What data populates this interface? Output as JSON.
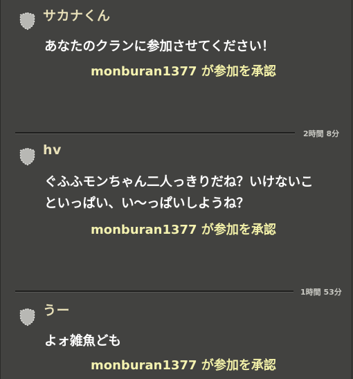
{
  "posts": [
    {
      "username": "サカナくん",
      "message": "あなたのクランに参加させてください！",
      "approval_member": "monburan1377",
      "approval_text": " が参加を承認"
    },
    {
      "username": "hv",
      "message": "ぐふふモンちゃん二人っきりだね？いけないこ\nといっぱい、い〜っぱいしようね？",
      "approval_member": "monburan1377",
      "approval_text": " が参加を承認"
    },
    {
      "username": "うー",
      "message": "よォ雑魚ども",
      "approval_member": "monburan1377",
      "approval_text": " が参加を承認"
    }
  ],
  "dividers": [
    {
      "time": "2時間 8分"
    },
    {
      "time": "1時間 53分"
    }
  ],
  "colors": {
    "background": "#424240",
    "username": "#e8e0b8",
    "message": "#ffffff",
    "approval": "#f2f0a8"
  },
  "icons": {
    "avatar": "shield-icon"
  }
}
